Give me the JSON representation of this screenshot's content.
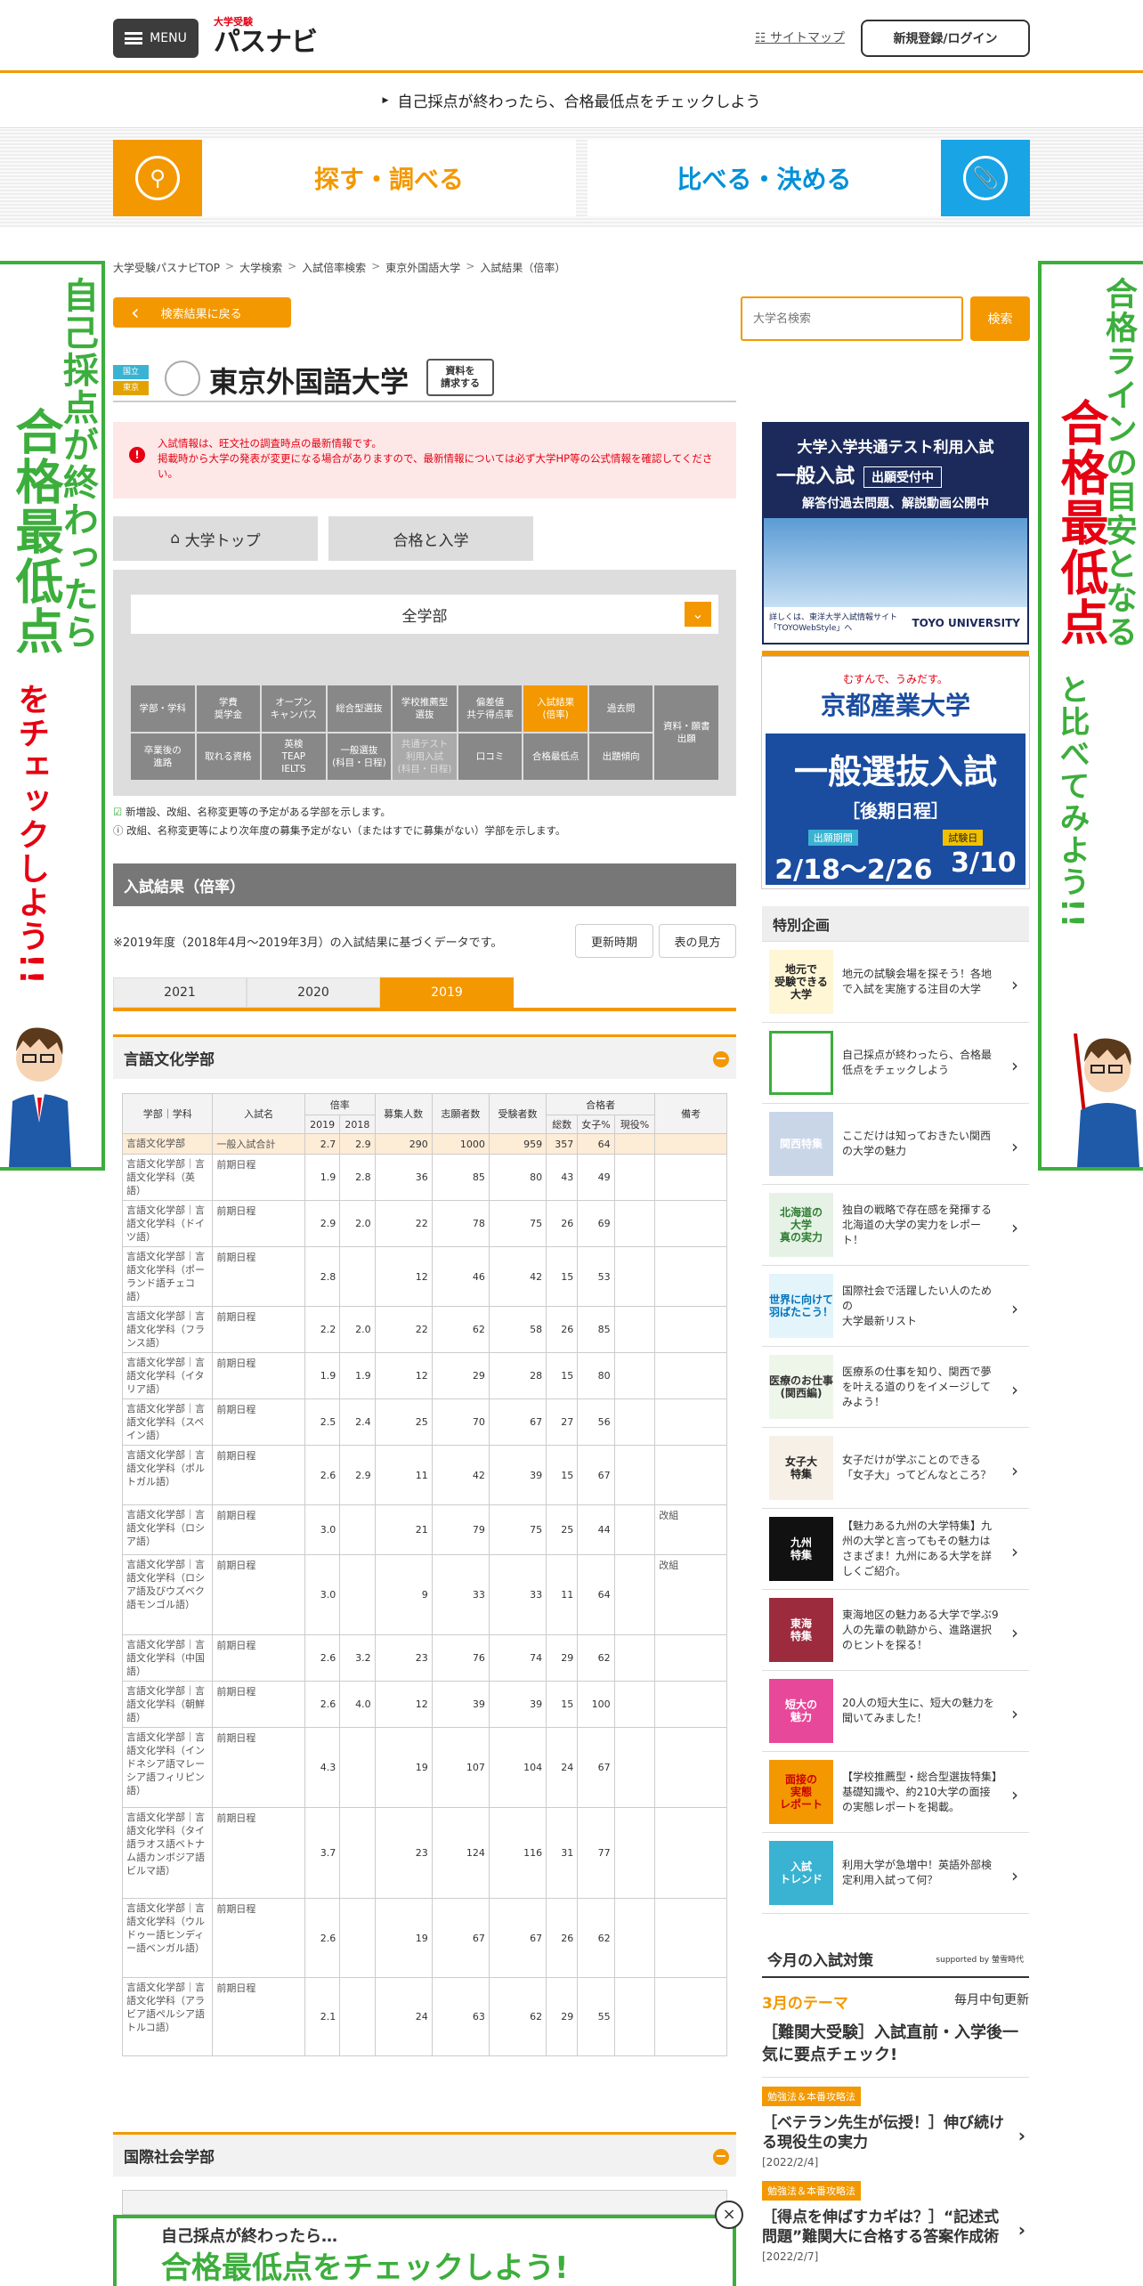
{
  "header": {
    "menu_label": "MENU",
    "logo_small": "大学受験",
    "logo_main": "パスナビ",
    "sitemap": "サイトマップ",
    "register": "新規登録/ログイン"
  },
  "notice": "自己採点が終わったら、合格最低点をチェックしよう",
  "nav": {
    "search": "探す・調べる",
    "compare": "比べる・決める"
  },
  "side_banner_left": {
    "line1": "自己採点が終わったら",
    "line2": "合格最低点",
    "line3": "をチェックしよう!!"
  },
  "side_banner_right": {
    "line1": "合格ラインの目安となる",
    "line2": "合格最低点",
    "line3": "と比べてみよう!!"
  },
  "breadcrumb": [
    "大学受験パスナビTOP",
    "大学検索",
    "入試倍率検索",
    "東京外国語大学",
    "入試結果（倍率）"
  ],
  "back_button": "検索結果に戻る",
  "search": {
    "placeholder": "大学名検索",
    "button": "検索"
  },
  "university": {
    "tag1": "国立",
    "tag2": "東京",
    "name": "東京外国語大学",
    "request_line1": "資料を",
    "request_line2": "請求する"
  },
  "warning": {
    "line1": "入試情報は、旺文社の調査時点の最新情報です。",
    "line2": "掲載時から大学の発表が変更になる場合がありますので、最新情報については必ず大学HP等の公式情報を確認してください。"
  },
  "tabs": {
    "top": "大学トップ",
    "admission": "合格と入学"
  },
  "faculty_select": "全学部",
  "grid_row1": [
    "学部・学科",
    "学費\n奨学金",
    "オープン\nキャンパス",
    "総合型選抜",
    "学校推薦型\n選抜",
    "偏差値\n共テ得点率",
    "入試結果\n(倍率)",
    "過去問"
  ],
  "grid_row2": [
    "卒業後の\n進路",
    "取れる資格",
    "英検\nTEAP\nIELTS",
    "一般選抜\n(科目・日程)",
    "共通テスト\n利用入試\n(科目・日程)",
    "口コミ",
    "合格最低点",
    "出題傾向"
  ],
  "grid_span": "資料・願書\n出願",
  "legend": [
    "新増設、改組、名称変更等の予定がある学部を示します。",
    "改組、名称変更等により次年度の募集予定がない（またはすでに募集がない）学部を示します。"
  ],
  "section_title": "入試結果（倍率）",
  "basis": "※2019年度（2018年4月～2019年3月）の入試結果に基づくデータです。",
  "buttons": {
    "update": "更新時期",
    "howto": "表の見方"
  },
  "year_tabs": [
    "2021",
    "2020",
    "2019"
  ],
  "dept1": "言語文化学部",
  "dept2": "国際社会学部",
  "table_headers": {
    "fac": "学部｜学科",
    "exam": "入試名",
    "ratio": "倍率",
    "y2019": "2019",
    "y2018": "2018",
    "quota": "募集人数",
    "applicants": "志願者数",
    "takers": "受験者数",
    "passers": "合格者",
    "total": "総数",
    "female": "女子%",
    "current": "現役%",
    "note": "備考"
  },
  "table_rows": [
    {
      "fac": "言語文化学部",
      "exam": "一般入試合計",
      "r19": "2.7",
      "r18": "2.9",
      "quota": "290",
      "app": "1000",
      "take": "959",
      "pass": "357",
      "fem": "64",
      "cur": "",
      "note": "",
      "hl": true
    },
    {
      "fac": "言語文化学部｜言語文化学科（英語）",
      "exam": "前期日程",
      "r19": "1.9",
      "r18": "2.8",
      "quota": "36",
      "app": "85",
      "take": "80",
      "pass": "43",
      "fem": "49",
      "cur": "",
      "note": ""
    },
    {
      "fac": "言語文化学部｜言語文化学科（ドイツ語）",
      "exam": "前期日程",
      "r19": "2.9",
      "r18": "2.0",
      "quota": "22",
      "app": "78",
      "take": "75",
      "pass": "26",
      "fem": "69",
      "cur": "",
      "note": ""
    },
    {
      "fac": "言語文化学部｜言語文化学科（ポーランド語チェコ語）",
      "exam": "前期日程",
      "r19": "2.8",
      "r18": "",
      "quota": "12",
      "app": "46",
      "take": "42",
      "pass": "15",
      "fem": "53",
      "cur": "",
      "note": ""
    },
    {
      "fac": "言語文化学部｜言語文化学科（フランス語）",
      "exam": "前期日程",
      "r19": "2.2",
      "r18": "2.0",
      "quota": "22",
      "app": "62",
      "take": "58",
      "pass": "26",
      "fem": "85",
      "cur": "",
      "note": ""
    },
    {
      "fac": "言語文化学部｜言語文化学科（イタリア語）",
      "exam": "前期日程",
      "r19": "1.9",
      "r18": "1.9",
      "quota": "12",
      "app": "29",
      "take": "28",
      "pass": "15",
      "fem": "80",
      "cur": "",
      "note": ""
    },
    {
      "fac": "言語文化学部｜言語文化学科（スペイン語）",
      "exam": "前期日程",
      "r19": "2.5",
      "r18": "2.4",
      "quota": "25",
      "app": "70",
      "take": "67",
      "pass": "27",
      "fem": "56",
      "cur": "",
      "note": ""
    },
    {
      "fac": "言語文化学部｜言語文化学科（ポルトガル語）",
      "exam": "前期日程",
      "r19": "2.6",
      "r18": "2.9",
      "quota": "11",
      "app": "42",
      "take": "39",
      "pass": "15",
      "fem": "67",
      "cur": "",
      "note": ""
    },
    {
      "fac": "言語文化学部｜言語文化学科（ロシア語）",
      "exam": "前期日程",
      "r19": "3.0",
      "r18": "",
      "quota": "21",
      "app": "79",
      "take": "75",
      "pass": "25",
      "fem": "44",
      "cur": "",
      "note": "改組"
    },
    {
      "fac": "言語文化学部｜言語文化学科（ロシア語及びウズベク語モンゴル語）",
      "exam": "前期日程",
      "r19": "3.0",
      "r18": "",
      "quota": "9",
      "app": "33",
      "take": "33",
      "pass": "11",
      "fem": "64",
      "cur": "",
      "note": "改組"
    },
    {
      "fac": "言語文化学部｜言語文化学科（中国語）",
      "exam": "前期日程",
      "r19": "2.6",
      "r18": "3.2",
      "quota": "23",
      "app": "76",
      "take": "74",
      "pass": "29",
      "fem": "62",
      "cur": "",
      "note": ""
    },
    {
      "fac": "言語文化学部｜言語文化学科（朝鮮語）",
      "exam": "前期日程",
      "r19": "2.6",
      "r18": "4.0",
      "quota": "12",
      "app": "39",
      "take": "39",
      "pass": "15",
      "fem": "100",
      "cur": "",
      "note": ""
    },
    {
      "fac": "言語文化学部｜言語文化学科（インドネシア語マレーシア語フィリピン語）",
      "exam": "前期日程",
      "r19": "4.3",
      "r18": "",
      "quota": "19",
      "app": "107",
      "take": "104",
      "pass": "24",
      "fem": "67",
      "cur": "",
      "note": ""
    },
    {
      "fac": "言語文化学部｜言語文化学科（タイ語ラオス語ベトナム語カンボジア語ビルマ語）",
      "exam": "前期日程",
      "r19": "3.7",
      "r18": "",
      "quota": "23",
      "app": "124",
      "take": "116",
      "pass": "31",
      "fem": "77",
      "cur": "",
      "note": ""
    },
    {
      "fac": "言語文化学部｜言語文化学科（ウルドゥー語ヒンディー語ベンガル語）",
      "exam": "前期日程",
      "r19": "2.6",
      "r18": "",
      "quota": "19",
      "app": "67",
      "take": "67",
      "pass": "26",
      "fem": "62",
      "cur": "",
      "note": ""
    },
    {
      "fac": "言語文化学部｜言語文化学科（アラビア語ペルシア語トルコ語）",
      "exam": "前期日程",
      "r19": "2.1",
      "r18": "",
      "quota": "24",
      "app": "63",
      "take": "62",
      "pass": "29",
      "fem": "55",
      "cur": "",
      "note": ""
    }
  ],
  "ad1": {
    "line1": "大学入学共通テスト利用入試",
    "line2": "一般入試",
    "badge": "出願受付中",
    "line3": "解答付過去問題、解説動画公開中",
    "foot": "詳しくは、東洋大学入試情報サイト\n「TOYOWebStyle」へ",
    "brand": "TOYO UNIVERSITY"
  },
  "ad2": {
    "catch": "むすんで、うみだす。",
    "name": "京都産業大学",
    "big": "一般選抜入試",
    "sub": "［後期日程］",
    "l1": "出願期間",
    "l2": "試験日",
    "d1": "2/18～2/26",
    "d2": "3/10"
  },
  "features": {
    "title": "特別企画",
    "items": [
      {
        "thumb": "地元で\n受験できる\n大学",
        "text": "地元の試験会場を探そう！各地で入試を実施する注目の大学",
        "bg": "#fff6d6",
        "fg": "#222"
      },
      {
        "thumb": "",
        "text": "自己採点が終わったら、合格最低点をチェックしよう",
        "bg": "#ffffff",
        "fg": "#3cae3c"
      },
      {
        "thumb": "関西特集",
        "text": "ここだけは知っておきたい関西の大学の魅力",
        "bg": "#c9d6e8",
        "fg": "#fff"
      },
      {
        "thumb": "北海道の\n大学\n真の実力",
        "text": "独自の戦略で存在感を発揮する北海道の大学の実力をレポート！",
        "bg": "#e6f2e6",
        "fg": "#2e7d32"
      },
      {
        "thumb": "世界に向けて\n羽ばたこう！",
        "text": "国際社会で活躍したい人のための\n大学最新リスト",
        "bg": "#e3f4fb",
        "fg": "#0072bc"
      },
      {
        "thumb": "医療のお仕事\n(関西編)",
        "text": "医療系の仕事を知り、関西で夢を叶える道のりをイメージしてみよう！",
        "bg": "#eef6ea",
        "fg": "#333"
      },
      {
        "thumb": "女子大\n特集",
        "text": "女子だけが学ぶことのできる「女子大」ってどんなところ？",
        "bg": "#f7f0e6",
        "fg": "#222"
      },
      {
        "thumb": "九州\n特集",
        "text": "【魅力ある九州の大学特集】九州の大学と言ってもその魅力はさまざま！九州にある大学を詳しくご紹介。",
        "bg": "#111111",
        "fg": "#fff"
      },
      {
        "thumb": "東海\n特集",
        "text": "東海地区の魅力ある大学で学ぶ9人の先輩の軌跡から、進路選択のヒントを探る！",
        "bg": "#9c2b3e",
        "fg": "#fff"
      },
      {
        "thumb": "短大の\n魅力",
        "text": "20人の短大生に、短大の魅力を聞いてみました！",
        "bg": "#e8489a",
        "fg": "#fff"
      },
      {
        "thumb": "面接の\n実態\nレポート",
        "text": "【学校推薦型・総合型選抜特集】基礎知識や、約210大学の面接の実態レポートを掲載。",
        "bg": "#f39800",
        "fg": "#c00"
      },
      {
        "thumb": "入試\nトレンド",
        "text": "利用大学が急増中！英語外部検定利用入試って何？",
        "bg": "#39b3d1",
        "fg": "#fff"
      }
    ]
  },
  "taisaku": {
    "title": "今月の入試対策",
    "supported": "supported by 螢雪時代",
    "theme_label": "3月のテーマ",
    "update": "毎月中旬更新",
    "theme_title": "［難関大受験］入試直前・入学後一気に要点チェック!",
    "badge": "勉強法＆本番攻略法",
    "art1": "［ベテラン先生が伝授！］伸び続ける現役生の実力",
    "art1_date": "[2022/2/4]",
    "art2": "［得点を伸ばすカギは？］“記述式問題”難関大に合格する答案作成術",
    "art2_date": "[2022/2/7]"
  },
  "floating": {
    "line1": "自己採点が終わったら…",
    "line2": "合格最低点をチェックしよう!"
  },
  "colors": {
    "accent": "#f39800",
    "green": "#3cae3c",
    "blue": "#0090d8",
    "red": "#e60012"
  }
}
